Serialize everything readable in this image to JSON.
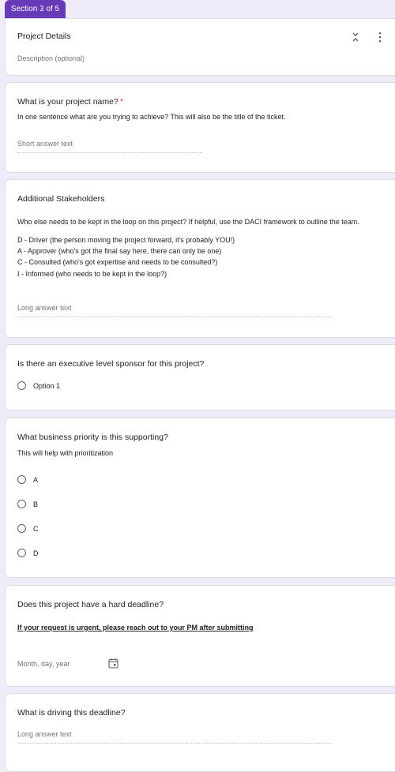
{
  "section_tab": "Section 3 of 5",
  "header": {
    "title": "Project Details",
    "description": "Description (optional)"
  },
  "q1": {
    "title": "What is your project name?",
    "required_mark": "*",
    "description": "In one sentence what are you trying to achieve? This will also be the title of the ticket.",
    "placeholder": "Short answer text"
  },
  "q2": {
    "title": "Additional Stakeholders",
    "description": "Who else needs to be kept in the loop on this project? If helpful, use the DACI framework to outline the team.",
    "lines": [
      "D - Driver (the person moving the project forward, it's probably YOU!)",
      "A - Approver (who's got the final say here, there can only be one)",
      "C - Consulted (who's got expertise and needs to be consulted?)",
      "I - Informed (who needs to be kept in the loop?)"
    ],
    "placeholder": "Long answer text"
  },
  "q3": {
    "title": "Is there an executive level sponsor for this project?",
    "options": [
      "Option 1"
    ]
  },
  "q4": {
    "title": "What business priority is this supporting?",
    "description": "This will help with prioritization",
    "options": [
      "A",
      "B",
      "C",
      "D"
    ]
  },
  "q5": {
    "title": "Does this project have a hard deadline?",
    "note": "If your request is urgent, please reach out to your PM after submitting",
    "date_placeholder": "Month, day, year"
  },
  "q6": {
    "title": "What is driving this deadline?",
    "placeholder": "Long answer text"
  },
  "colors": {
    "accent": "#673ab7",
    "background": "#f0ebf8",
    "required": "#d93025"
  }
}
